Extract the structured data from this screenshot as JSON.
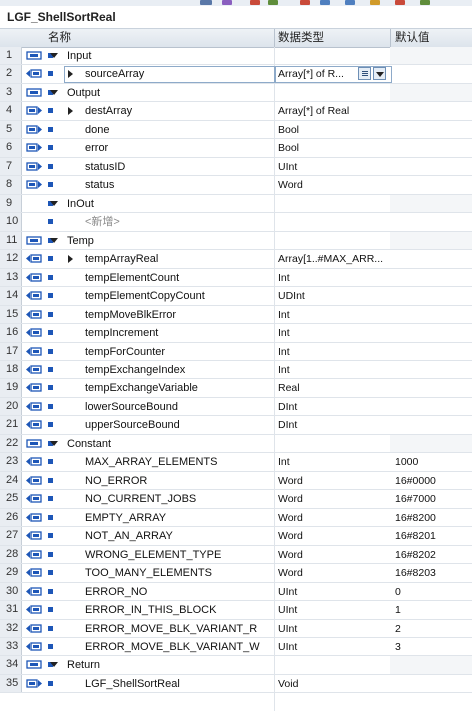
{
  "title": "LGF_ShellSortReal",
  "header": {
    "name": "名称",
    "datatype": "数据类型",
    "default": "默认值"
  },
  "rows": [
    {
      "num": "1",
      "level": 0,
      "name": "Input",
      "type": "",
      "default": "",
      "section": true,
      "icon": "interface-icon",
      "expand": "down"
    },
    {
      "num": "2",
      "level": 1,
      "name": "sourceArray",
      "type": "Array[*] of R...",
      "default": "",
      "icon": "input-var-icon",
      "expand": "right",
      "selected": true
    },
    {
      "num": "3",
      "level": 0,
      "name": "Output",
      "type": "",
      "default": "",
      "section": true,
      "icon": "interface-icon",
      "expand": "down"
    },
    {
      "num": "4",
      "level": 1,
      "name": "destArray",
      "type": "Array[*] of Real",
      "default": "",
      "icon": "output-var-icon",
      "expand": "right"
    },
    {
      "num": "5",
      "level": 1,
      "name": "done",
      "type": "Bool",
      "default": "",
      "icon": "output-var-icon"
    },
    {
      "num": "6",
      "level": 1,
      "name": "error",
      "type": "Bool",
      "default": "",
      "icon": "output-var-icon"
    },
    {
      "num": "7",
      "level": 1,
      "name": "statusID",
      "type": "UInt",
      "default": "",
      "icon": "output-var-icon"
    },
    {
      "num": "8",
      "level": 1,
      "name": "status",
      "type": "Word",
      "default": "",
      "icon": "output-var-icon"
    },
    {
      "num": "9",
      "level": 0,
      "name": "InOut",
      "type": "",
      "default": "",
      "section": true,
      "expand": "down"
    },
    {
      "num": "10",
      "level": 1,
      "name": "<新增>",
      "type": "",
      "default": "",
      "placeholder": true
    },
    {
      "num": "11",
      "level": 0,
      "name": "Temp",
      "type": "",
      "default": "",
      "section": true,
      "icon": "interface-icon",
      "expand": "down"
    },
    {
      "num": "12",
      "level": 1,
      "name": "tempArrayReal",
      "type": "Array[1..#MAX_ARR...",
      "default": "",
      "icon": "temp-var-icon",
      "expand": "right"
    },
    {
      "num": "13",
      "level": 1,
      "name": "tempElementCount",
      "type": "Int",
      "default": "",
      "icon": "temp-var-icon"
    },
    {
      "num": "14",
      "level": 1,
      "name": "tempElementCopyCount",
      "type": "UDInt",
      "default": "",
      "icon": "temp-var-icon"
    },
    {
      "num": "15",
      "level": 1,
      "name": "tempMoveBlkError",
      "type": "Int",
      "default": "",
      "icon": "temp-var-icon"
    },
    {
      "num": "16",
      "level": 1,
      "name": "tempIncrement",
      "type": "Int",
      "default": "",
      "icon": "temp-var-icon"
    },
    {
      "num": "17",
      "level": 1,
      "name": "tempForCounter",
      "type": "Int",
      "default": "",
      "icon": "temp-var-icon"
    },
    {
      "num": "18",
      "level": 1,
      "name": "tempExchangeIndex",
      "type": "Int",
      "default": "",
      "icon": "temp-var-icon"
    },
    {
      "num": "19",
      "level": 1,
      "name": "tempExchangeVariable",
      "type": "Real",
      "default": "",
      "icon": "temp-var-icon"
    },
    {
      "num": "20",
      "level": 1,
      "name": "lowerSourceBound",
      "type": "DInt",
      "default": "",
      "icon": "temp-var-icon"
    },
    {
      "num": "21",
      "level": 1,
      "name": "upperSourceBound",
      "type": "DInt",
      "default": "",
      "icon": "temp-var-icon"
    },
    {
      "num": "22",
      "level": 0,
      "name": "Constant",
      "type": "",
      "default": "",
      "section": true,
      "icon": "interface-icon",
      "expand": "down"
    },
    {
      "num": "23",
      "level": 1,
      "name": "MAX_ARRAY_ELEMENTS",
      "type": "Int",
      "default": "1000",
      "icon": "constant-icon"
    },
    {
      "num": "24",
      "level": 1,
      "name": "NO_ERROR",
      "type": "Word",
      "default": "16#0000",
      "icon": "constant-icon"
    },
    {
      "num": "25",
      "level": 1,
      "name": "NO_CURRENT_JOBS",
      "type": "Word",
      "default": "16#7000",
      "icon": "constant-icon"
    },
    {
      "num": "26",
      "level": 1,
      "name": "EMPTY_ARRAY",
      "type": "Word",
      "default": "16#8200",
      "icon": "constant-icon"
    },
    {
      "num": "27",
      "level": 1,
      "name": "NOT_AN_ARRAY",
      "type": "Word",
      "default": "16#8201",
      "icon": "constant-icon"
    },
    {
      "num": "28",
      "level": 1,
      "name": "WRONG_ELEMENT_TYPE",
      "type": "Word",
      "default": "16#8202",
      "icon": "constant-icon"
    },
    {
      "num": "29",
      "level": 1,
      "name": "TOO_MANY_ELEMENTS",
      "type": "Word",
      "default": "16#8203",
      "icon": "constant-icon"
    },
    {
      "num": "30",
      "level": 1,
      "name": "ERROR_NO",
      "type": "UInt",
      "default": "0",
      "icon": "constant-icon"
    },
    {
      "num": "31",
      "level": 1,
      "name": "ERROR_IN_THIS_BLOCK",
      "type": "UInt",
      "default": "1",
      "icon": "constant-icon"
    },
    {
      "num": "32",
      "level": 1,
      "name": "ERROR_MOVE_BLK_VARIANT_R",
      "type": "UInt",
      "default": "2",
      "icon": "constant-icon"
    },
    {
      "num": "33",
      "level": 1,
      "name": "ERROR_MOVE_BLK_VARIANT_W",
      "type": "UInt",
      "default": "3",
      "icon": "constant-icon"
    },
    {
      "num": "34",
      "level": 0,
      "name": "Return",
      "type": "",
      "default": "",
      "section": true,
      "icon": "interface-icon",
      "expand": "down"
    },
    {
      "num": "35",
      "level": 1,
      "name": "LGF_ShellSortReal",
      "type": "Void",
      "default": "",
      "icon": "return-icon"
    }
  ],
  "colors": {
    "accent": "#1d56b7",
    "header_bg": "#dde4ec",
    "row_num_bg": "#e9edf2",
    "selected_border": "#8eaac9"
  }
}
